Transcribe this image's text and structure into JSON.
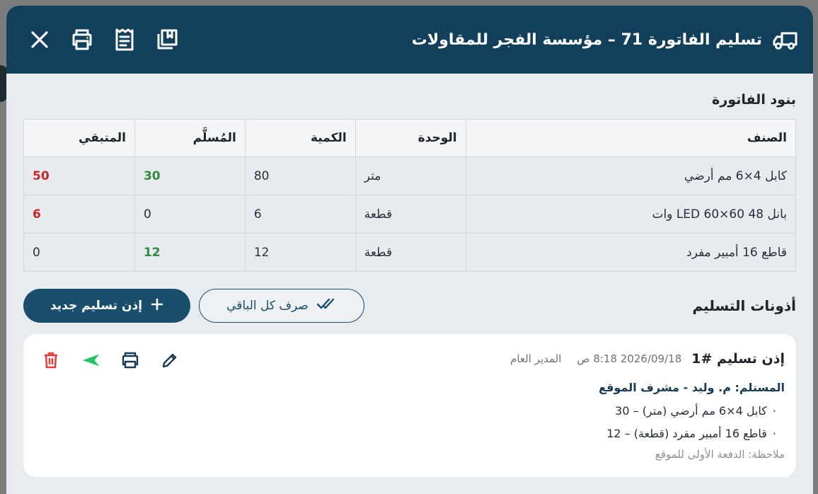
{
  "header": {
    "title": "تسليم الفاتورة 71 – مؤسسة الفجر للمقاولات",
    "title_icon": "truck-icon",
    "actions": [
      "close-icon",
      "print-icon",
      "receipt-icon",
      "book-icon"
    ]
  },
  "items_section": {
    "title": "بنود الفاتورة",
    "columns": [
      "الصنف",
      "الوحدة",
      "الكمية",
      "المُسلَّم",
      "المتبقي"
    ],
    "rows": [
      {
        "name": "كابل 4×6 مم أرضي",
        "unit": "متر",
        "qty": "80",
        "delivered": "30",
        "remaining": "50"
      },
      {
        "name": "بانل LED 60×60 48 وات",
        "unit": "قطعة",
        "qty": "6",
        "delivered": "0",
        "remaining": "6"
      },
      {
        "name": "قاطع 16 أمبير مفرد",
        "unit": "قطعة",
        "qty": "12",
        "delivered": "12",
        "remaining": "0"
      }
    ]
  },
  "notes_section": {
    "title": "أذونات التسليم",
    "new_button": "إذن تسليم جديد",
    "dispense_button": "صرف كل الباقي"
  },
  "delivery_card": {
    "title": "إذن تسليم #1",
    "datetime": "2026/09/18 8:18 ص",
    "user": "المدير العام",
    "recipient": "المستلم: م. وليد - مشرف الموقع",
    "lines": [
      "كابل 4×6 مم أرضي (متر) – 30",
      "قاطع 16 أمبير مفرد (قطعة) – 12"
    ],
    "note": "ملاحظة: الدفعة الأولى للموقع"
  },
  "colors": {
    "header_bg": "#12405a",
    "primary": "#1a4e6d",
    "red": "#c62828",
    "green": "#2e8b3a",
    "send_green": "#22c55e"
  }
}
